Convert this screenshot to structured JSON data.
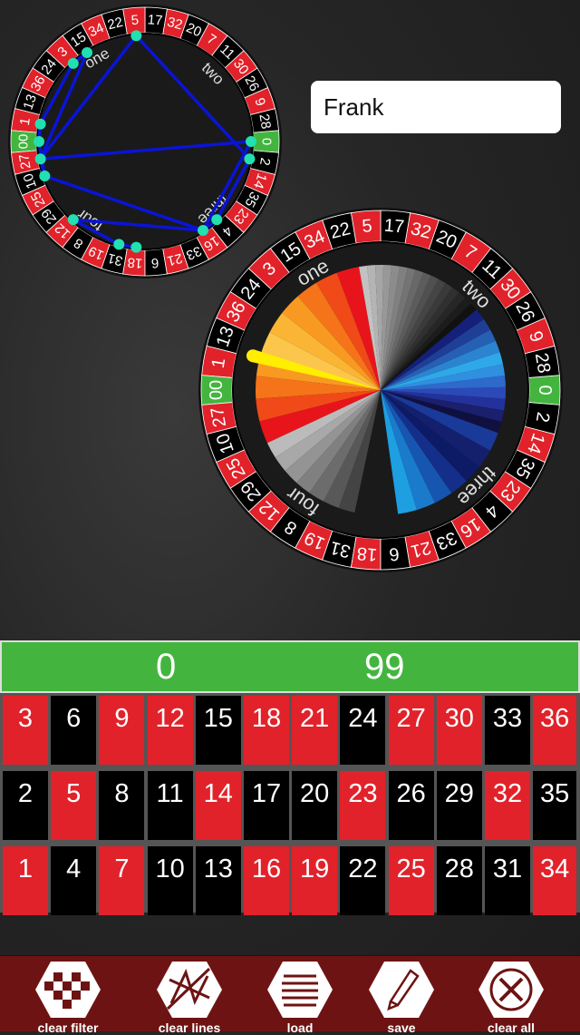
{
  "wheel_order": [
    "0",
    "28",
    "9",
    "26",
    "30",
    "11",
    "7",
    "20",
    "32",
    "17",
    "5",
    "22",
    "34",
    "15",
    "3",
    "24",
    "36",
    "13",
    "1",
    "00",
    "27",
    "10",
    "25",
    "29",
    "12",
    "8",
    "19",
    "31",
    "18",
    "6",
    "21",
    "33",
    "16",
    "4",
    "23",
    "35",
    "14",
    "2"
  ],
  "sector_labels": [
    "one",
    "two",
    "three",
    "four"
  ],
  "player_name": "Frank",
  "range": {
    "min": "0",
    "max": "99"
  },
  "table_rows": [
    [
      {
        "n": "3",
        "c": "red"
      },
      {
        "n": "6",
        "c": "black"
      },
      {
        "n": "9",
        "c": "red"
      },
      {
        "n": "12",
        "c": "red"
      },
      {
        "n": "15",
        "c": "black"
      },
      {
        "n": "18",
        "c": "red"
      },
      {
        "n": "21",
        "c": "red"
      },
      {
        "n": "24",
        "c": "black"
      },
      {
        "n": "27",
        "c": "red"
      },
      {
        "n": "30",
        "c": "red"
      },
      {
        "n": "33",
        "c": "black"
      },
      {
        "n": "36",
        "c": "red"
      }
    ],
    [
      {
        "n": "2",
        "c": "black"
      },
      {
        "n": "5",
        "c": "red"
      },
      {
        "n": "8",
        "c": "black"
      },
      {
        "n": "11",
        "c": "black"
      },
      {
        "n": "14",
        "c": "red"
      },
      {
        "n": "17",
        "c": "black"
      },
      {
        "n": "20",
        "c": "black"
      },
      {
        "n": "23",
        "c": "red"
      },
      {
        "n": "26",
        "c": "black"
      },
      {
        "n": "29",
        "c": "black"
      },
      {
        "n": "32",
        "c": "red"
      },
      {
        "n": "35",
        "c": "black"
      }
    ],
    [
      {
        "n": "1",
        "c": "red"
      },
      {
        "n": "4",
        "c": "black"
      },
      {
        "n": "7",
        "c": "red"
      },
      {
        "n": "10",
        "c": "black"
      },
      {
        "n": "13",
        "c": "black"
      },
      {
        "n": "16",
        "c": "red"
      },
      {
        "n": "19",
        "c": "red"
      },
      {
        "n": "22",
        "c": "black"
      },
      {
        "n": "25",
        "c": "red"
      },
      {
        "n": "28",
        "c": "black"
      },
      {
        "n": "31",
        "c": "black"
      },
      {
        "n": "34",
        "c": "red"
      }
    ]
  ],
  "toolbar": {
    "clear_filter": "clear filter",
    "clear_lines": "clear lines",
    "load": "load",
    "save": "save",
    "clear_all": "clear all"
  },
  "line_path": [
    "18",
    "31",
    "12",
    "16",
    "4",
    "2",
    "5",
    "27",
    "10",
    "00",
    "1",
    "3",
    "15",
    "27",
    "0",
    "16",
    "10"
  ],
  "colors": {
    "red": "#e1222a",
    "black": "#000000",
    "green": "#43b53f",
    "line": "#0a14d6",
    "dot": "#22e0b0",
    "pointer": "#ffee00",
    "toolbar": "#6e1313"
  }
}
